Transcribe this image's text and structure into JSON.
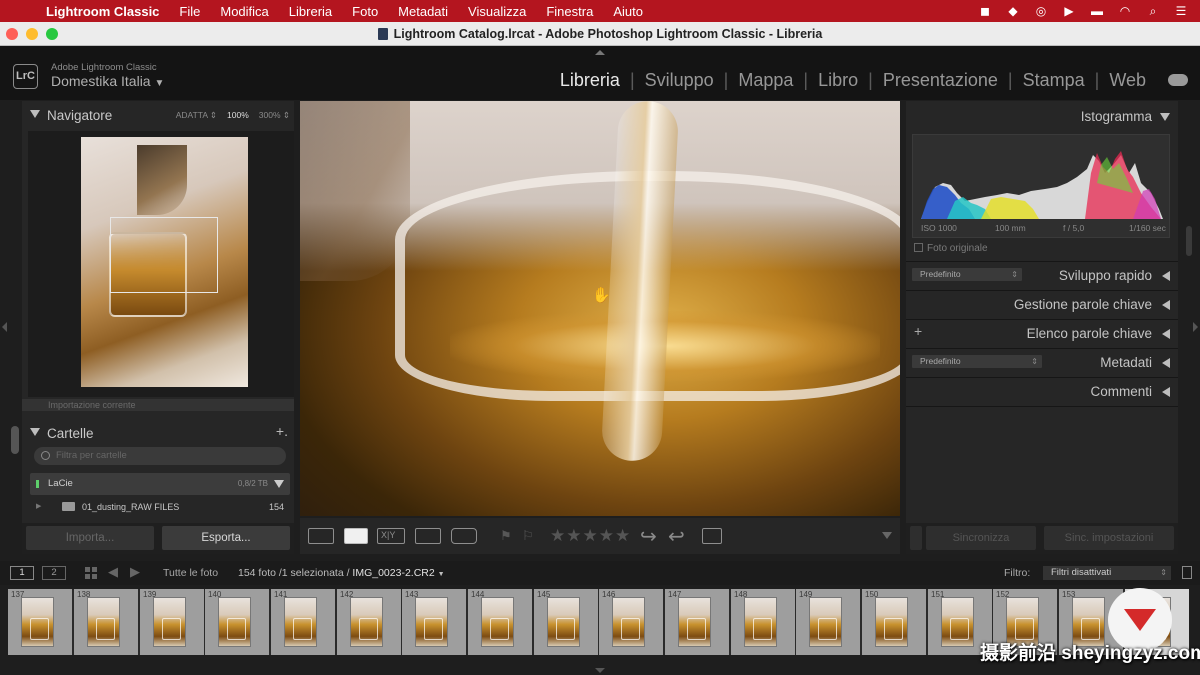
{
  "menubar": {
    "app": "Lightroom Classic",
    "items": [
      "File",
      "Modifica",
      "Libreria",
      "Foto",
      "Metadati",
      "Visualizza",
      "Finestra",
      "Aiuto"
    ],
    "bg_color": "#b4151f"
  },
  "window": {
    "title": "Lightroom Catalog.lrcat - Adobe Photoshop Lightroom Classic - Libreria"
  },
  "header": {
    "logo": "LrC",
    "app_label": "Adobe Lightroom Classic",
    "identity": "Domestika Italia",
    "modules": [
      "Libreria",
      "Sviluppo",
      "Mappa",
      "Libro",
      "Presentazione",
      "Stampa",
      "Web"
    ],
    "active_module": "Libreria"
  },
  "left_panel": {
    "navigator": {
      "title": "Navigatore",
      "zoom_options": [
        "ADATTA ⇕",
        "100%",
        "300% ⇕"
      ],
      "active_zoom": "100%"
    },
    "collapsed_label": "Importazione corrente",
    "folders": {
      "title": "Cartelle",
      "search_placeholder": "Filtra per cartelle",
      "volume": {
        "name": "LaCie",
        "capacity": "0,8/2 TB",
        "status_color": "#5ecf6b"
      },
      "folder": {
        "name": "01_dusting_RAW FILES",
        "count": "154"
      }
    },
    "buttons": {
      "import": "Importa...",
      "export": "Esporta..."
    }
  },
  "toolbar": {
    "view_xy": "X|Y",
    "stars": "★★★★★"
  },
  "right_panel": {
    "histogram": {
      "title": "Istogramma",
      "iso": "ISO 1000",
      "focal": "100 mm",
      "aperture": "f / 5,0",
      "shutter": "1/160 sec",
      "original_photo": "Foto originale"
    },
    "sections": {
      "quick_develop": "Sviluppo rapido",
      "keywording": "Gestione parole chiave",
      "keyword_list": "Elenco parole chiave",
      "metadata": "Metadati",
      "comments": "Commenti"
    },
    "presets": {
      "quick": "Predefinito",
      "metadata": "Predefinito"
    },
    "buttons": {
      "sync": "Sincronizza",
      "sync_settings": "Sinc. impostazioni"
    }
  },
  "filmstrip_bar": {
    "view1": "1",
    "view2": "2",
    "source": "Tutte le foto",
    "count_text": "154 foto /1 selezionata /",
    "filename": "IMG_0023-2.CR2",
    "filter_label": "Filtro:",
    "filter_value": "Filtri disattivati"
  },
  "filmstrip": {
    "numbers": [
      "137",
      "138",
      "139",
      "140",
      "141",
      "142",
      "143",
      "144",
      "145",
      "146",
      "147",
      "148",
      "149",
      "150",
      "151",
      "152",
      "153"
    ]
  },
  "watermark": {
    "text": "摄影前沿 sheyingzyz.com"
  }
}
